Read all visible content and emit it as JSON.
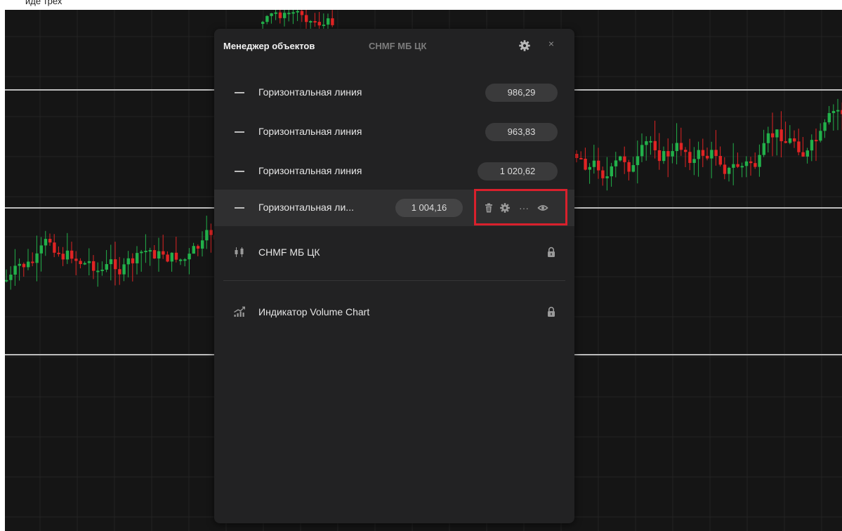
{
  "top_text": "иде трех",
  "panel": {
    "title": "Менеджер объектов",
    "symbol": "CHMF МБ ЦК",
    "settings_icon": "gear-icon",
    "close_label": "×"
  },
  "objects": [
    {
      "label": "Горизонтальная линия",
      "value": "986,29",
      "icon": "horizontal-line-icon"
    },
    {
      "label": "Горизонтальная линия",
      "value": "963,83",
      "icon": "horizontal-line-icon"
    },
    {
      "label": "Горизонтальная линия",
      "value": "1 020,62",
      "icon": "horizontal-line-icon"
    },
    {
      "label": "Горизонтальная ли...",
      "value": "1 004,16",
      "icon": "horizontal-line-icon",
      "hovered": true,
      "actions": [
        "trash-icon",
        "gear-icon",
        "more-icon",
        "eye-icon"
      ],
      "more_label": "···"
    }
  ],
  "instrument": {
    "label": "CHMF МБ ЦК",
    "icon": "candles-icon",
    "locked": true
  },
  "indicator": {
    "label": "Индикатор Volume Chart",
    "icon": "indicator-icon",
    "locked": true
  },
  "colors": {
    "panel_bg": "#222223",
    "chart_bg": "#151515",
    "bull": "#22b04a",
    "bear": "#e02424",
    "highlight": "#d9202c"
  }
}
